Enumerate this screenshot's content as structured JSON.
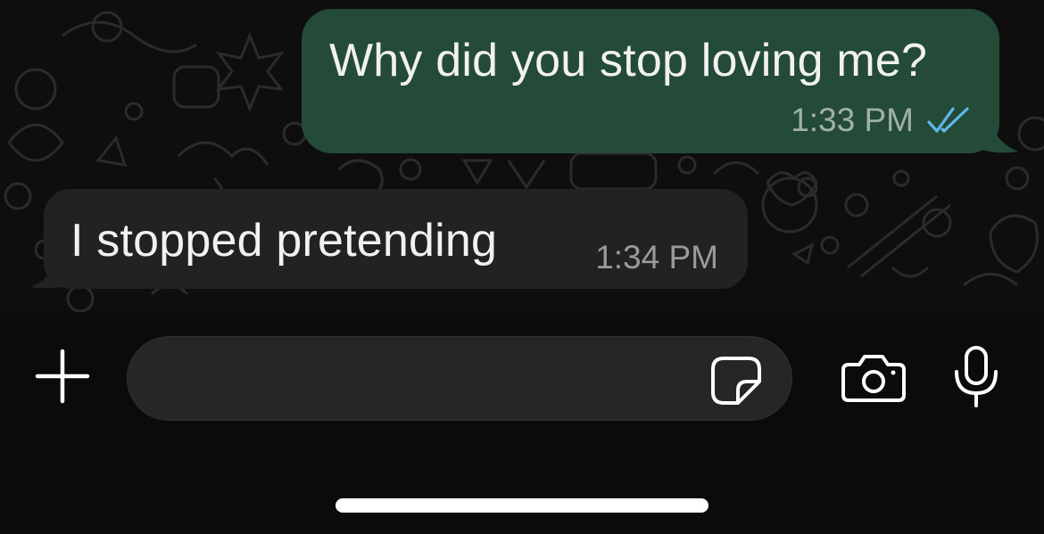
{
  "messages": [
    {
      "direction": "outgoing",
      "text": "Why did you stop loving me?",
      "time": "1:33 PM",
      "status_icon": "double-check-read-icon"
    },
    {
      "direction": "incoming",
      "text": "I stopped pretending",
      "time": "1:34 PM"
    }
  ],
  "composer": {
    "input_value": "",
    "input_placeholder": "",
    "icons": [
      "plus-icon",
      "sticker-icon",
      "camera-icon",
      "microphone-icon"
    ]
  },
  "colors": {
    "background": "#0b0b0b",
    "outgoing_bubble": "#244a38",
    "incoming_bubble": "#222222",
    "read_ticks": "#5fb7e8",
    "input_pill": "#262626"
  }
}
